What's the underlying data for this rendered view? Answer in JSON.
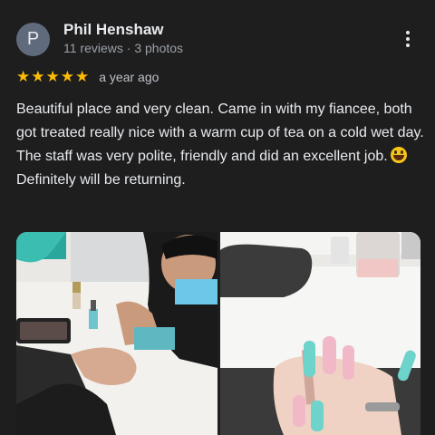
{
  "reviewer": {
    "initial": "P",
    "name": "Phil Henshaw",
    "meta": "11 reviews · 3 photos"
  },
  "review": {
    "rating": 5,
    "stars": [
      "★",
      "★",
      "★",
      "★",
      "★"
    ],
    "time": "a year ago",
    "text_main": "Beautiful place and very clean. Came in with my fiancee, both got treated really nice with a warm cup of tea on a cold wet day. The staff was very polite, friendly and did an excellent job.",
    "text_followup": "Definitely will be returning."
  },
  "icons": {
    "more": "more-vert-icon",
    "star": "star-icon",
    "emoji": "grinning-face-with-tongue-emoji"
  },
  "colors": {
    "background": "#1e1e1f",
    "star": "#fbbc04",
    "avatar_bg": "#5f6b7c",
    "text_secondary": "#9aa0a6"
  }
}
